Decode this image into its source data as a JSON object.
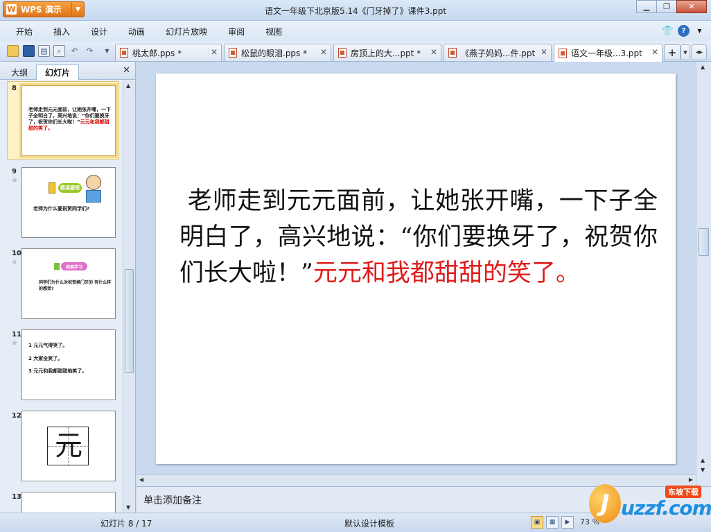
{
  "app": {
    "name": "WPS 演示",
    "window_title": "语文一年级下北京版5.14《门牙掉了》课件3.ppt"
  },
  "menu": [
    "开始",
    "插入",
    "设计",
    "动画",
    "幻灯片放映",
    "审阅",
    "视图"
  ],
  "doc_tabs": [
    {
      "label": "桃太郎.pps *",
      "active": false
    },
    {
      "label": "松鼠的眼泪.pps *",
      "active": false
    },
    {
      "label": "房顶上的大...ppt *",
      "active": false
    },
    {
      "label": "《燕子妈妈...件.ppt",
      "active": false
    },
    {
      "label": "语文一年级...3.ppt",
      "active": true
    }
  ],
  "left_pane": {
    "tabs": [
      "大纲",
      "幻灯片"
    ],
    "active_tab": "幻灯片",
    "thumbnails": [
      {
        "num": "8",
        "selected": true,
        "text_black": "老师走到元元面前，让她张开嘴，一下子全明白了，高兴地说：“你们要换牙了，祝贺你们长大啦！”",
        "text_red": "元元和我都甜甜的笑了。"
      },
      {
        "num": "9",
        "star": "☆",
        "badge": "精读感悟",
        "caption": "老师为什么要祝贺同学们?"
      },
      {
        "num": "10",
        "star": "☆",
        "badge": "拓展学习",
        "caption": "同学们为什么对祝贺换门牙的 有什么样的感受?"
      },
      {
        "num": "11",
        "star": "☆",
        "lines": [
          "1 元元气得哭了。",
          "2 大家全笑了。",
          "3 元元和我都甜甜地笑了。"
        ]
      },
      {
        "num": "12",
        "char": "元"
      },
      {
        "num": "13"
      }
    ]
  },
  "slide": {
    "text_black": "老师走到元元面前，让她张开嘴，一下子全明白了，高兴地说：“你们要换牙了，祝贺你们长大啦！”",
    "text_red": "元元和我都甜甜的笑了。"
  },
  "notes_placeholder": "单击添加备注",
  "status": {
    "slide_indicator": "幻灯片 8 / 17",
    "template": "默认设计模板",
    "zoom": "73 %"
  },
  "watermark": {
    "site": "uzzf.com",
    "tag": "东坡下载"
  },
  "colors": {
    "accent_orange": "#e0731a",
    "slide_red": "#e01b1b",
    "chrome_blue": "#c9d9ee"
  }
}
